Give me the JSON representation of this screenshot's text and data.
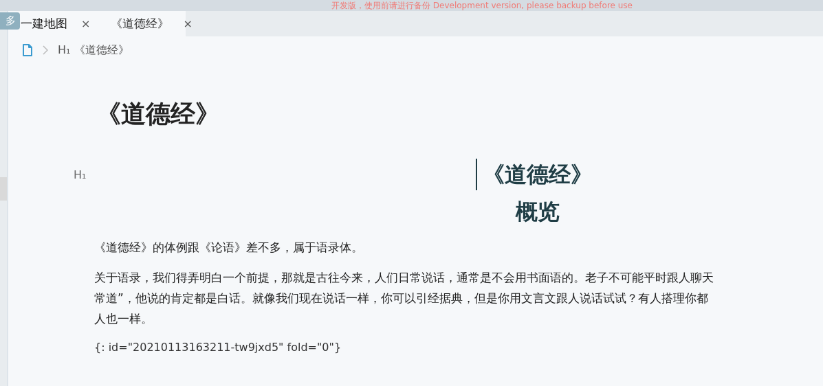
{
  "banner": {
    "text": "开发版，使用前请进行备份 Development version, please backup before use"
  },
  "tabs": [
    {
      "label": "一建地图",
      "close": "×",
      "selected": true
    },
    {
      "label": "《道德经》",
      "close": "×",
      "selected": false
    }
  ],
  "tooltip": {
    "text": "多"
  },
  "breadcrumb": {
    "heading_mark": "H₁",
    "title": "《道德经》"
  },
  "document": {
    "title": "《道德经》",
    "block_mark": "H₁",
    "quote_heading": "《道德经》",
    "section_heading": "概览",
    "paragraphs": [
      {
        "lines": [
          "《道德经》的体例跟《论语》差不多，属于语录体。"
        ]
      },
      {
        "lines": [
          "关于语录，我们得弄明白一个前提，那就是古往今来，人们日常说话，通常是不会用书面语的。老子不可能平时跟人聊天",
          "常道”，他说的肯定都是白话。就像我们现在说话一样，你可以引经据典，但是你用文言文跟人说话试试？有人搭理你都",
          "人也一样。"
        ]
      }
    ],
    "attribute_line": "{: id=\"20210113163211-tw9jxd5\" fold=\"0\"}"
  }
}
